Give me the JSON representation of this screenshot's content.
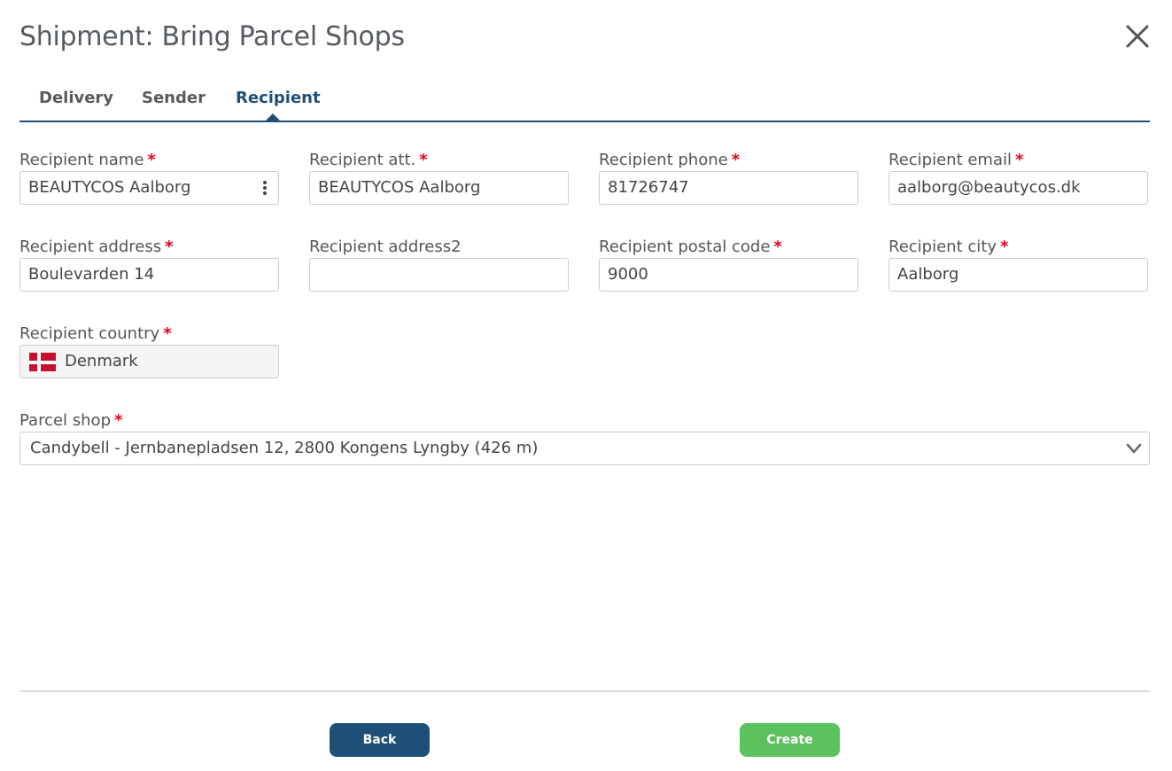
{
  "dialog": {
    "title": "Shipment: Bring Parcel Shops"
  },
  "tabs": [
    {
      "label": "Delivery",
      "active": false
    },
    {
      "label": "Sender",
      "active": false
    },
    {
      "label": "Recipient",
      "active": true
    }
  ],
  "required_marker": "*",
  "fields": {
    "recipient_name": {
      "label": "Recipient name",
      "value": "BEAUTYCOS Aalborg",
      "required": true
    },
    "recipient_att": {
      "label": "Recipient att.",
      "value": "BEAUTYCOS Aalborg",
      "required": true
    },
    "recipient_phone": {
      "label": "Recipient phone",
      "value": "81726747",
      "required": true
    },
    "recipient_email": {
      "label": "Recipient email",
      "value": "aalborg@beautycos.dk",
      "required": true
    },
    "recipient_address": {
      "label": "Recipient address",
      "value": "Boulevarden 14",
      "required": true
    },
    "recipient_address2": {
      "label": "Recipient address2",
      "value": "",
      "required": false
    },
    "recipient_postal_code": {
      "label": "Recipient postal code",
      "value": "9000",
      "required": true
    },
    "recipient_city": {
      "label": "Recipient city",
      "value": "Aalborg",
      "required": true
    },
    "recipient_country": {
      "label": "Recipient country",
      "value": "Denmark",
      "flag_icon": "denmark-flag-icon",
      "required": true
    },
    "parcel_shop": {
      "label": "Parcel shop",
      "value": "Candybell - Jernbanepladsen 12, 2800 Kongens Lyngby (426 m)",
      "required": true
    }
  },
  "footer": {
    "back_label": "Back",
    "create_label": "Create"
  },
  "colors": {
    "primary": "#1e5077",
    "success": "#5cc15f",
    "required": "#e3001b"
  },
  "icons": {
    "close": "close-icon",
    "more": "kebab-menu-icon",
    "dropdown": "chevron-down-icon"
  }
}
